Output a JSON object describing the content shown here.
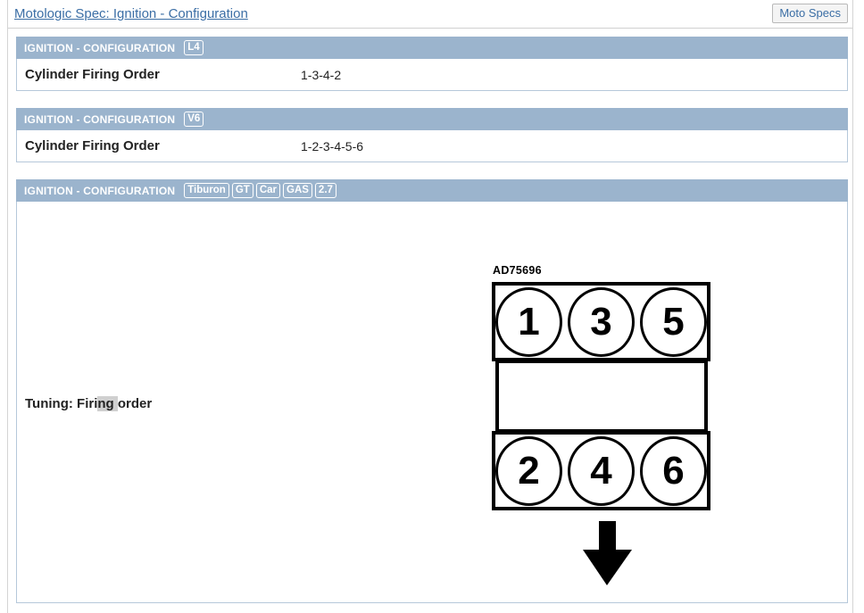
{
  "header": {
    "title_link": "Motologic Spec: Ignition - Configuration",
    "moto_specs_button": "Moto Specs"
  },
  "colors": {
    "panel_header_bg": "#9bb4cd",
    "panel_border": "#b6c8da",
    "link": "#3b6ea5",
    "highlight": "#d0d0d0",
    "diagram_stroke": "#000000"
  },
  "panels": [
    {
      "heading": "IGNITION - CONFIGURATION",
      "badges": [
        "L4"
      ],
      "rows": [
        {
          "label": "Cylinder Firing Order",
          "value": "1-3-4-2"
        }
      ]
    },
    {
      "heading": "IGNITION - CONFIGURATION",
      "badges": [
        "V6"
      ],
      "rows": [
        {
          "label": "Cylinder Firing Order",
          "value": "1-2-3-4-5-6"
        }
      ]
    },
    {
      "heading": "IGNITION - CONFIGURATION",
      "badges": [
        "Tiburon",
        "GT",
        "Car",
        "GAS",
        "2.7"
      ],
      "tuning": {
        "label_before": "Tuning: Firi",
        "label_highlight": "ng ",
        "label_after": "order",
        "full_label": "Tuning: Firing order"
      }
    }
  ],
  "diagram": {
    "code": "AD75696",
    "bank_top": [
      "1",
      "3",
      "5"
    ],
    "bank_middle": [],
    "bank_bottom": [
      "2",
      "4",
      "6"
    ],
    "arrow_direction": "down"
  }
}
